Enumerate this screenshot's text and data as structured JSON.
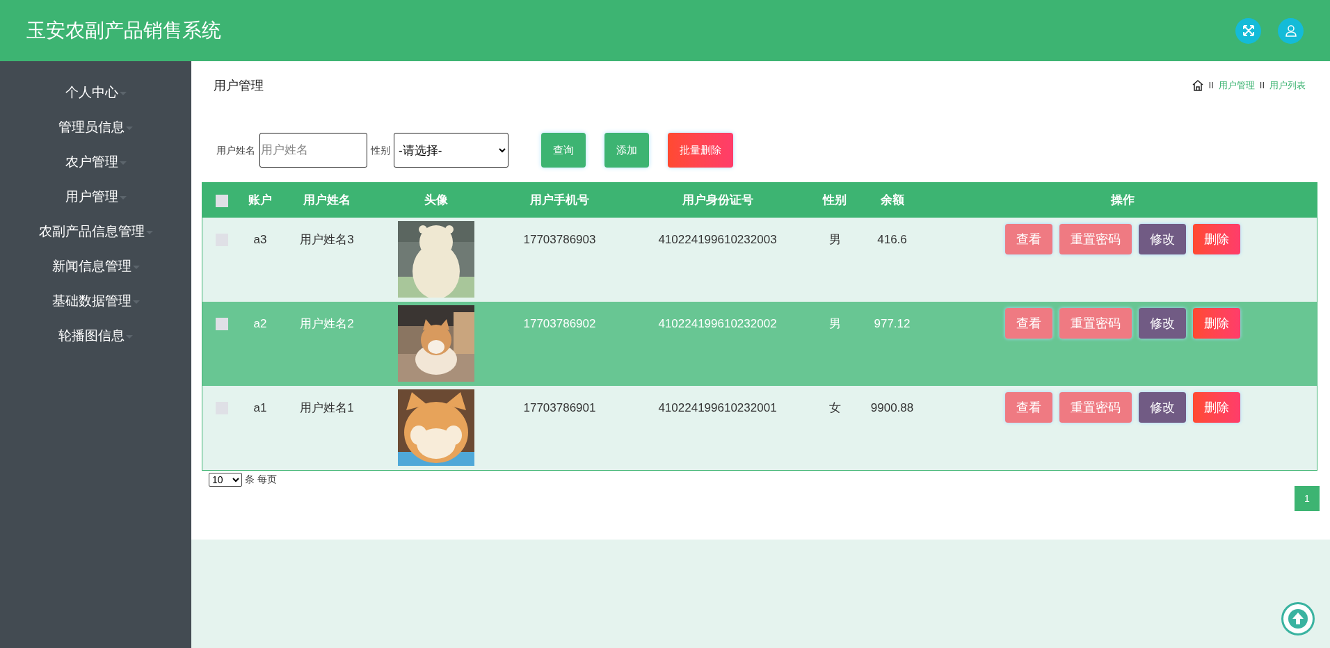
{
  "header": {
    "title": "玉安农副产品销售系统"
  },
  "sidebar": {
    "items": [
      {
        "label": "个人中心"
      },
      {
        "label": "管理员信息"
      },
      {
        "label": "农户管理"
      },
      {
        "label": "用户管理"
      },
      {
        "label": "农副产品信息管理"
      },
      {
        "label": "新闻信息管理"
      },
      {
        "label": "基础数据管理"
      },
      {
        "label": "轮播图信息"
      }
    ]
  },
  "page_title": "用户管理",
  "breadcrumb": {
    "items": [
      {
        "separator": "II",
        "label": "用户管理"
      },
      {
        "separator": "II",
        "label": "用户列表"
      }
    ]
  },
  "search": {
    "name_label": "用户姓名",
    "name_placeholder": "用户姓名",
    "gender_label": "性别",
    "gender_value": "-请选择-",
    "buttons": [
      {
        "label": "查询",
        "kind": "primary"
      },
      {
        "label": "添加",
        "kind": "primary"
      },
      {
        "label": "批量删除",
        "kind": "danger"
      }
    ]
  },
  "table": {
    "select_all_checked": false,
    "columns": [
      "账户",
      "用户姓名",
      "头像",
      "用户手机号",
      "用户身份证号",
      "性别",
      "余额",
      "操作"
    ],
    "rows": [
      {
        "checked": false,
        "highlighted": false,
        "account": "a3",
        "name": "用户姓名3",
        "phone": "17703786903",
        "id_number": "410224199610232003",
        "gender": "男",
        "balance": "416.6",
        "actions": [
          {
            "label": "查看",
            "kind": "view"
          },
          {
            "label": "重置密码",
            "kind": "reset"
          },
          {
            "label": "修改",
            "kind": "edit"
          },
          {
            "label": "删除",
            "kind": "delete"
          }
        ]
      },
      {
        "checked": false,
        "highlighted": true,
        "account": "a2",
        "name": "用户姓名2",
        "phone": "17703786902",
        "id_number": "410224199610232002",
        "gender": "男",
        "balance": "977.12",
        "actions": [
          {
            "label": "查看",
            "kind": "view"
          },
          {
            "label": "重置密码",
            "kind": "reset"
          },
          {
            "label": "修改",
            "kind": "edit"
          },
          {
            "label": "删除",
            "kind": "delete"
          }
        ]
      },
      {
        "checked": false,
        "highlighted": false,
        "account": "a1",
        "name": "用户姓名1",
        "phone": "17703786901",
        "id_number": "410224199610232001",
        "gender": "女",
        "balance": "9900.88",
        "actions": [
          {
            "label": "查看",
            "kind": "view"
          },
          {
            "label": "重置密码",
            "kind": "reset"
          },
          {
            "label": "修改",
            "kind": "edit"
          },
          {
            "label": "删除",
            "kind": "delete"
          }
        ]
      }
    ]
  },
  "pagination": {
    "page_size": "10",
    "page_size_suffix": "条 每页",
    "pages": [
      {
        "label": "1",
        "selected": true
      }
    ]
  }
}
